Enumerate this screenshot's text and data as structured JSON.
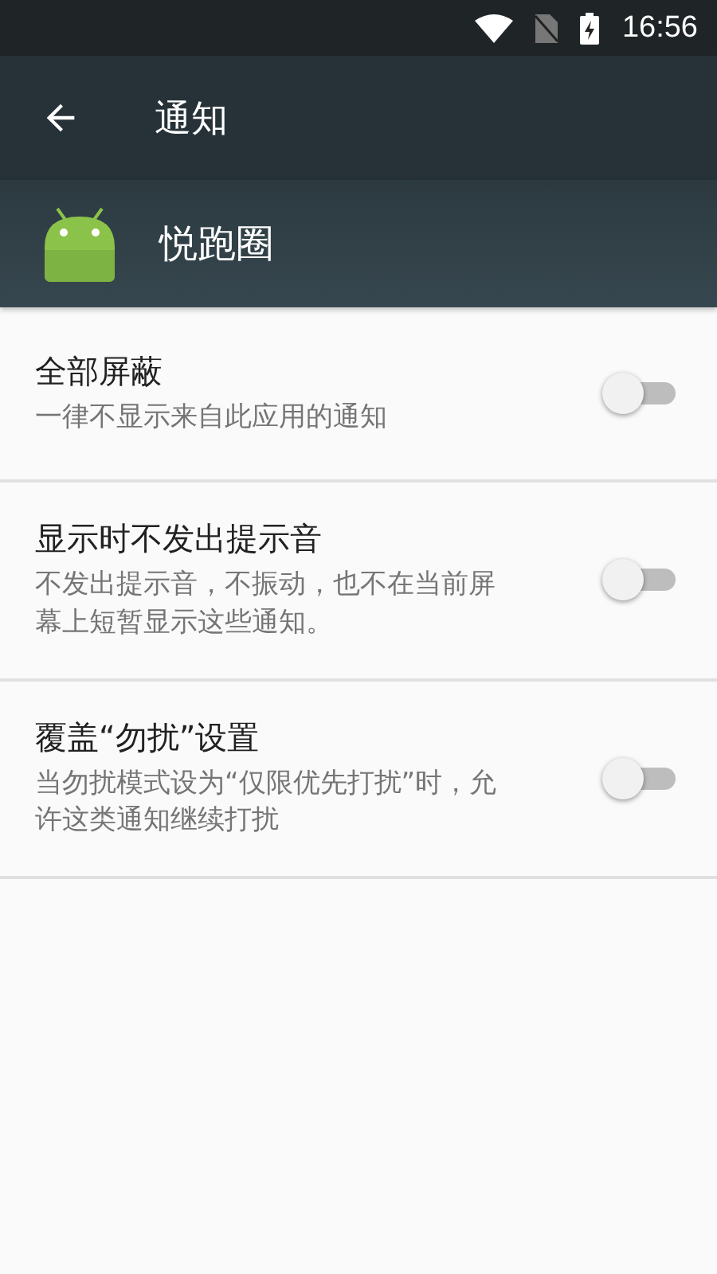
{
  "status_bar": {
    "time": "16:56"
  },
  "toolbar": {
    "title": "通知"
  },
  "app": {
    "name": "悦跑圈"
  },
  "settings": [
    {
      "title": "全部屏蔽",
      "description": "一律不显示来自此应用的通知",
      "on": false
    },
    {
      "title": "显示时不发出提示音",
      "description": "不发出提示音，不振动，也不在当前屏幕上短暂显示这些通知。",
      "on": false
    },
    {
      "title": "覆盖“勿扰”设置",
      "description": "当勿扰模式设为“仅限优先打扰”时，允许这类通知继续打扰",
      "on": false
    }
  ]
}
